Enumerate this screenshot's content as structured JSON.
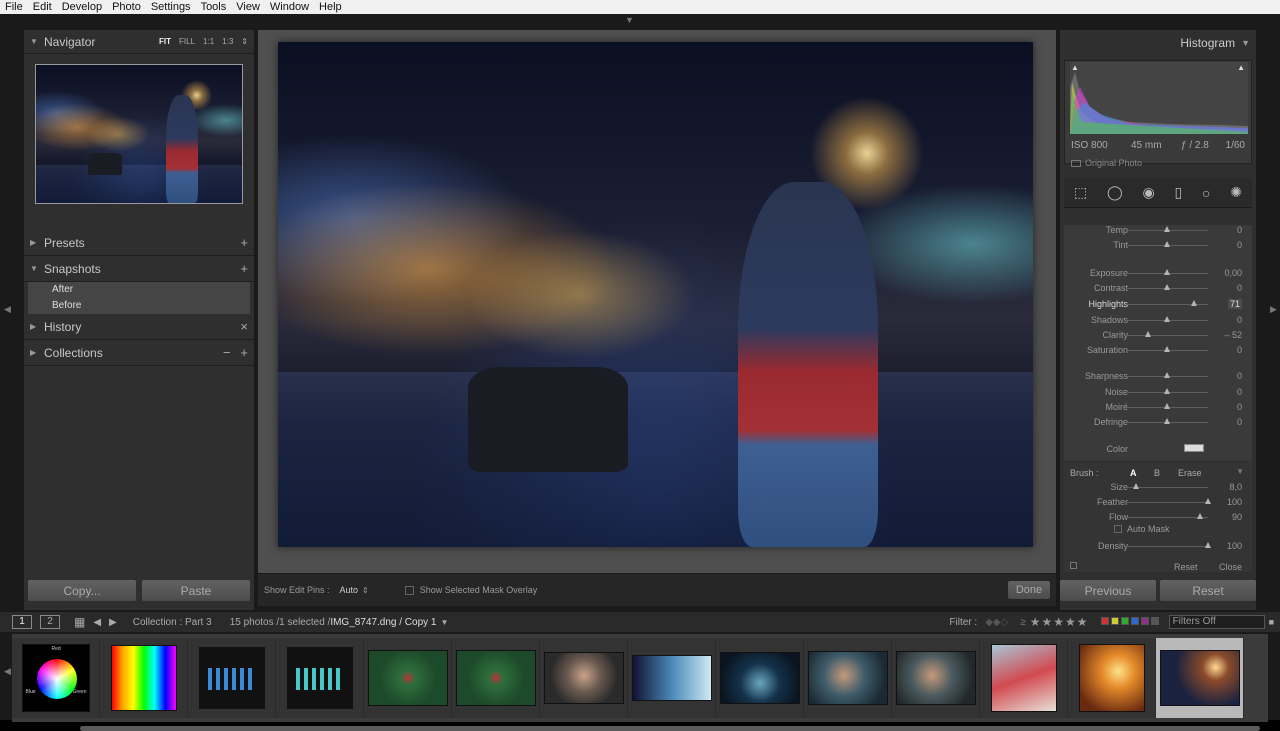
{
  "menu": [
    "File",
    "Edit",
    "Develop",
    "Photo",
    "Settings",
    "Tools",
    "View",
    "Window",
    "Help"
  ],
  "navigator": {
    "title": "Navigator",
    "options": [
      "FIT",
      "FILL",
      "1:1",
      "1:3"
    ]
  },
  "left_sections": {
    "presets": {
      "title": "Presets",
      "action": "+"
    },
    "snapshots": {
      "title": "Snapshots",
      "action": "+",
      "items": [
        "After",
        "Before"
      ]
    },
    "history": {
      "title": "History",
      "action": "×"
    },
    "collections": {
      "title": "Collections",
      "action_minus": "−",
      "action_plus": "+"
    }
  },
  "left_buttons": {
    "copy": "Copy...",
    "paste": "Paste"
  },
  "toolbar": {
    "show_edit_pins_label": "Show Edit Pins :",
    "show_edit_pins_value": "Auto",
    "mask_overlay_label": "Show Selected Mask Overlay",
    "done": "Done"
  },
  "histogram": {
    "title": "Histogram",
    "iso": "ISO 800",
    "focal": "45 mm",
    "aperture": "ƒ / 2.8",
    "shutter": "1/60",
    "original_photo": "Original Photo"
  },
  "sliders": [
    {
      "label": "Temp",
      "value": "0",
      "pos": 0.5
    },
    {
      "label": "Tint",
      "value": "0",
      "pos": 0.5
    },
    {
      "label": "Exposure",
      "value": "0,00",
      "pos": 0.5
    },
    {
      "label": "Contrast",
      "value": "0",
      "pos": 0.5
    },
    {
      "label": "Highlights",
      "value": "71",
      "pos": 0.83,
      "active": true
    },
    {
      "label": "Shadows",
      "value": "0",
      "pos": 0.5
    },
    {
      "label": "Clarity",
      "value": "– 52",
      "pos": 0.27
    },
    {
      "label": "Saturation",
      "value": "0",
      "pos": 0.5
    },
    {
      "label": "Sharpness",
      "value": "0",
      "pos": 0.5
    },
    {
      "label": "Noise",
      "value": "0",
      "pos": 0.5
    },
    {
      "label": "Moiré",
      "value": "0",
      "pos": 0.5
    },
    {
      "label": "Defringe",
      "value": "0",
      "pos": 0.5
    }
  ],
  "color_label": "Color",
  "brush": {
    "label": "Brush :",
    "a": "A",
    "b": "B",
    "erase": "Erase",
    "size_label": "Size",
    "size_value": "8,0",
    "size_pos": 0.12,
    "feather_label": "Feather",
    "feather_value": "100",
    "feather_pos": 1,
    "flow_label": "Flow",
    "flow_value": "90",
    "flow_pos": 0.9,
    "auto_mask": "Auto Mask",
    "density_label": "Density",
    "density_value": "100",
    "density_pos": 1,
    "reset": "Reset",
    "close": "Close"
  },
  "right_buttons": {
    "previous": "Previous",
    "reset": "Reset"
  },
  "stripbar": {
    "screen1": "1",
    "screen2": "2",
    "source": "Collection : Part 3",
    "count": "15 photos /1 selected /",
    "filename": "IMG_8747.dng / Copy 1",
    "filter_label": "Filter :",
    "stars": "★★★★★",
    "filters_off": "Filters Off"
  },
  "filmstrip": {
    "count": 14,
    "selected_index": 13,
    "wheel_labels": [
      "Red",
      "Blue",
      "Green"
    ]
  }
}
